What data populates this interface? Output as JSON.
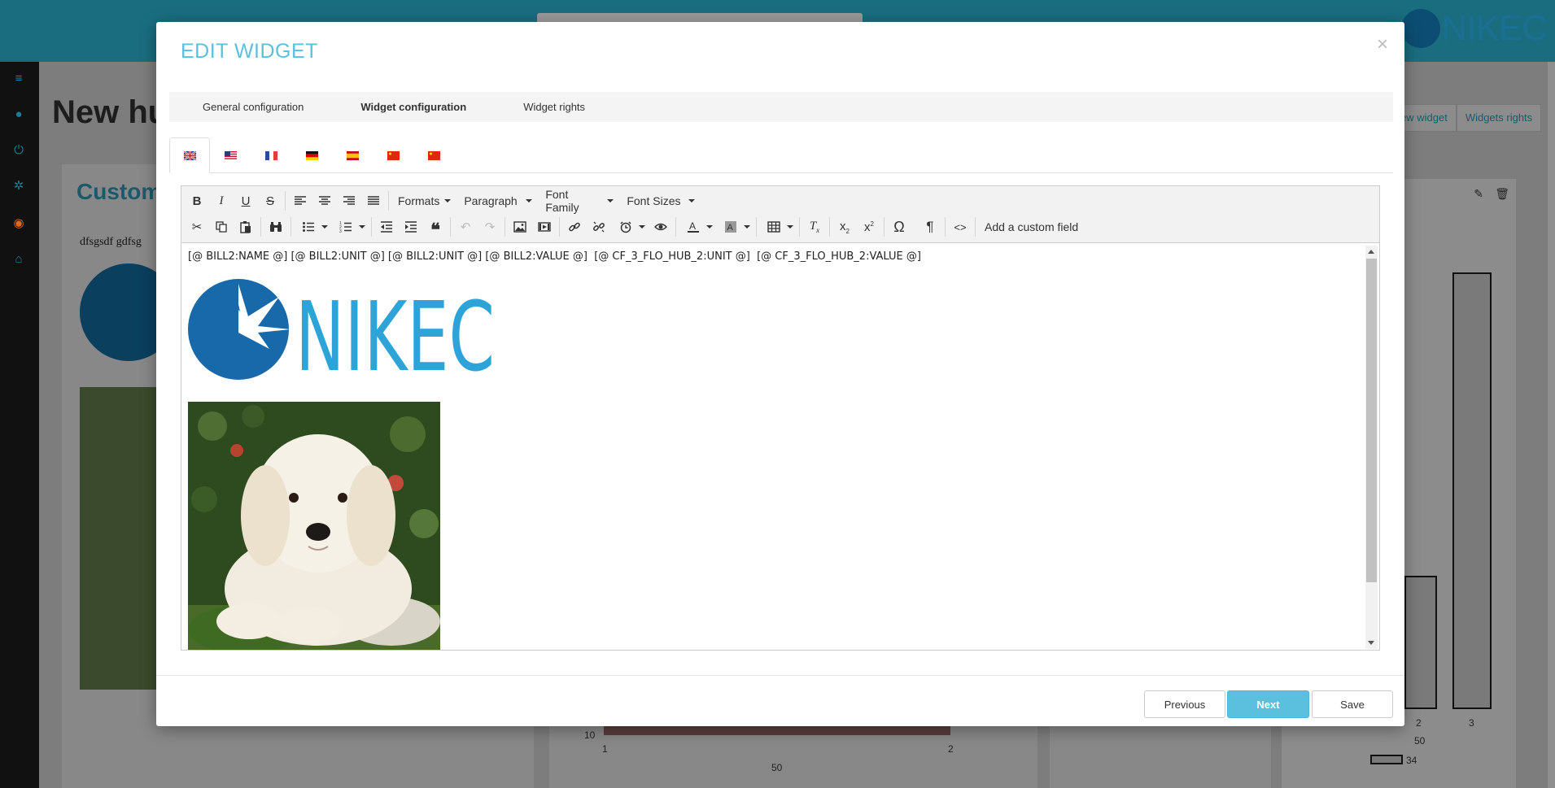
{
  "background": {
    "page_title": "New hu",
    "card_title": "Custom",
    "card_text": "dfsgsdf gdfsg",
    "buttons": [
      "ew widget",
      "Widgets rights"
    ],
    "chart_ticks_x": [
      "2",
      "3"
    ],
    "chart_label_50": "50",
    "chart_legend_value": "34",
    "mid_ticks": [
      "10",
      "1",
      "2"
    ],
    "mid_label_50": "50",
    "logo_text": "NIKEC"
  },
  "modal": {
    "title": "EDIT WIDGET",
    "close_icon": "close-icon",
    "tabs": [
      {
        "label": "General configuration",
        "active": false
      },
      {
        "label": "Widget configuration",
        "active": true
      },
      {
        "label": "Widget rights",
        "active": false
      }
    ],
    "languages": [
      {
        "name": "flag-gb-icon",
        "active": true
      },
      {
        "name": "flag-us-icon",
        "active": false
      },
      {
        "name": "flag-fr-icon",
        "active": false
      },
      {
        "name": "flag-de-icon",
        "active": false
      },
      {
        "name": "flag-es-icon",
        "active": false
      },
      {
        "name": "flag-cn-icon",
        "active": false
      },
      {
        "name": "flag-cn-icon",
        "active": false
      }
    ],
    "toolbar": {
      "formats": "Formats",
      "paragraph": "Paragraph",
      "font_family": "Font Family",
      "font_sizes": "Font Sizes",
      "custom_field": "Add a custom field",
      "omega": "Ω",
      "pilcrow": "¶",
      "code": "<>"
    },
    "content": {
      "fields_line": "[@ BILL2:NAME @] [@ BILL2:UNIT @] [@ BILL2:UNIT @] [@ BILL2:VALUE @]  [@ CF_3_FLO_HUB_2:UNIT @]  [@ CF_3_FLO_HUB_2:VALUE @]",
      "logo_text": "NIKEC"
    },
    "footer": {
      "previous": "Previous",
      "next": "Next",
      "save": "Save"
    }
  },
  "colors": {
    "accent": "#5bc0de",
    "logo_blue": "#2ea3d8",
    "logo_dark": "#1769aa"
  }
}
